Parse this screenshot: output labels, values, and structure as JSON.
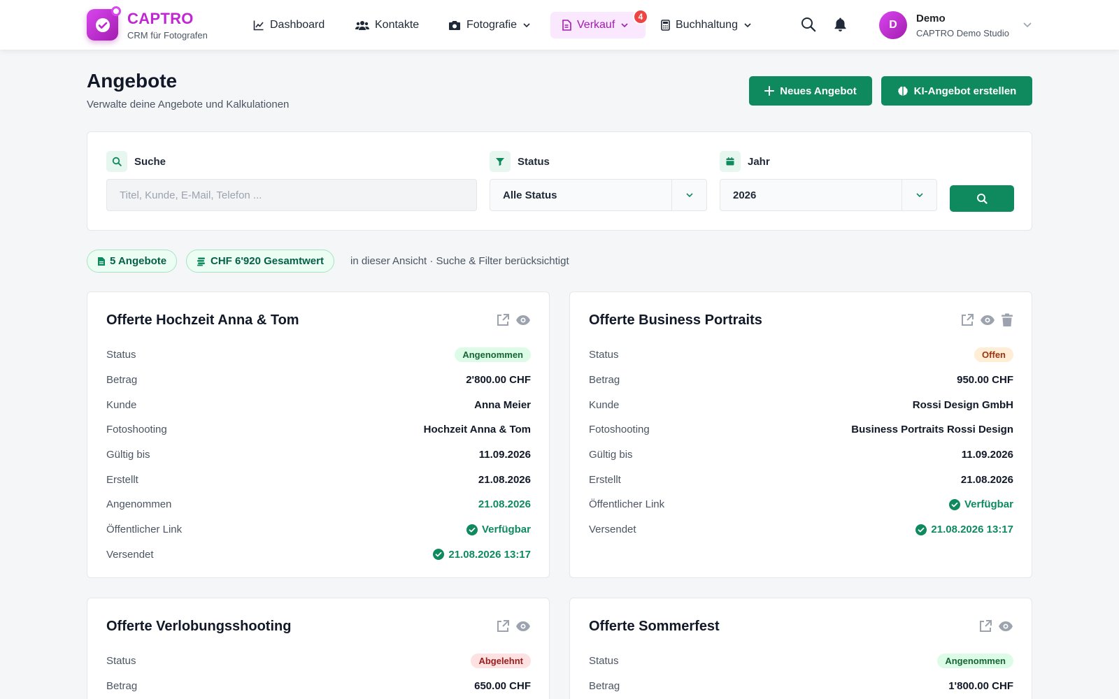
{
  "brand": {
    "name": "CAPTRO",
    "subtitle": "CRM für Fotografen"
  },
  "nav": {
    "dashboard": "Dashboard",
    "contacts": "Kontakte",
    "photography": "Fotografie",
    "sales": "Verkauf",
    "sales_badge": "4",
    "accounting": "Buchhaltung"
  },
  "user": {
    "initial": "D",
    "name": "Demo",
    "studio": "CAPTRO Demo Studio"
  },
  "header": {
    "title": "Angebote",
    "subtitle": "Verwalte deine Angebote und Kalkulationen",
    "new_offer": "Neues Angebot",
    "ai_offer": "KI-Angebot erstellen"
  },
  "filters": {
    "search_label": "Suche",
    "search_placeholder": "Titel, Kunde, E-Mail, Telefon ...",
    "status_label": "Status",
    "status_value": "Alle Status",
    "year_label": "Jahr",
    "year_value": "2026"
  },
  "summary": {
    "count": "5 Angebote",
    "total": "CHF 6'920 Gesamtwert",
    "note": "in dieser Ansicht · Suche & Filter berücksichtigt"
  },
  "labels": {
    "status": "Status",
    "amount": "Betrag",
    "customer": "Kunde",
    "shoot": "Fotoshooting",
    "valid": "Gültig bis",
    "created": "Erstellt",
    "accepted": "Angenommen",
    "public_link": "Öffentlicher Link",
    "sent": "Versendet"
  },
  "offers": [
    {
      "title": "Offerte Hochzeit Anna & Tom",
      "status": "Angenommen",
      "amount": "2'800.00 CHF",
      "customer": "Anna Meier",
      "shoot": "Hochzeit Anna & Tom",
      "valid": "11.09.2026",
      "created": "21.08.2026",
      "accepted": "21.08.2026",
      "public_link": "Verfügbar",
      "sent": "21.08.2026 13:17"
    },
    {
      "title": "Offerte Business Portraits",
      "status": "Offen",
      "amount": "950.00 CHF",
      "customer": "Rossi Design GmbH",
      "shoot": "Business Portraits Rossi Design",
      "valid": "11.09.2026",
      "created": "21.08.2026",
      "public_link": "Verfügbar",
      "sent": "21.08.2026 13:17"
    },
    {
      "title": "Offerte Verlobungsshooting",
      "status": "Abgelehnt",
      "amount": "650.00 CHF"
    },
    {
      "title": "Offerte Sommerfest",
      "status": "Angenommen",
      "amount": "1'800.00 CHF"
    }
  ],
  "colors": {
    "brand": "#c026d3",
    "primary_green": "#0f8a5f",
    "badge_red": "#ef4444"
  }
}
